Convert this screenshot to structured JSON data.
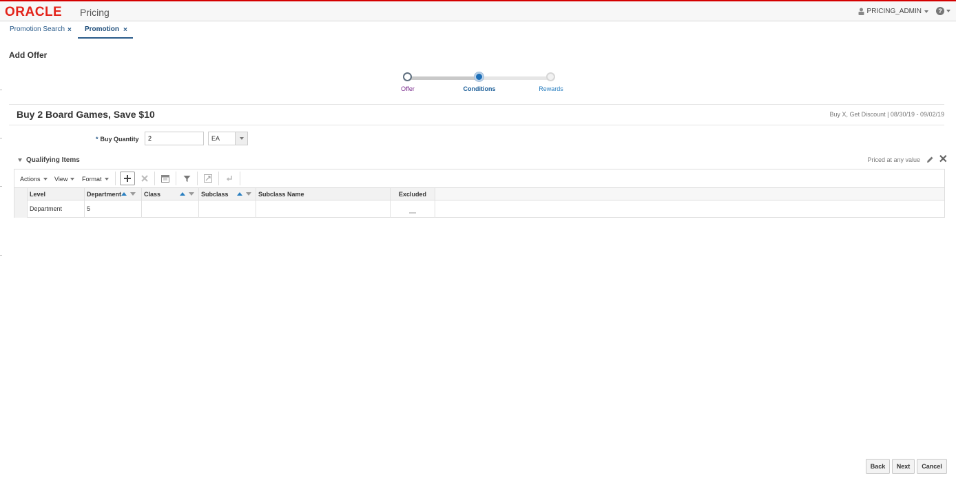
{
  "header": {
    "brand": "ORACLE",
    "app_name": "Pricing",
    "user": "PRICING_ADMIN",
    "help_glyph": "?"
  },
  "tabs": [
    {
      "label": "Promotion Search",
      "close": "×"
    },
    {
      "label": "Promotion",
      "close": "×"
    }
  ],
  "page": {
    "title": "Add Offer"
  },
  "train": {
    "steps": [
      {
        "label": "Offer",
        "state": "visited",
        "color": "#7b2d8e"
      },
      {
        "label": "Conditions",
        "state": "current",
        "color": "#1d5f99"
      },
      {
        "label": "Rewards",
        "state": "unvisited",
        "color": "#2a7fc0"
      }
    ]
  },
  "offer": {
    "title": "Buy 2 Board Games, Save $10",
    "meta": "Buy X, Get Discount | 08/30/19 - 09/02/19"
  },
  "form": {
    "buy_quantity_label": "Buy Quantity",
    "buy_quantity_value": "2",
    "uom_value": "EA",
    "required_marker": "*"
  },
  "qualifying": {
    "title": "Qualifying Items",
    "priced_label": "Priced at any value",
    "toolbar": {
      "actions": "Actions",
      "view": "View",
      "format": "Format"
    },
    "columns": [
      "Level",
      "Department",
      "Class",
      "Subclass",
      "Subclass Name",
      "Excluded"
    ],
    "rows": [
      {
        "level": "Department",
        "department": "5",
        "class": "",
        "subclass": "",
        "subclass_name": ""
      }
    ]
  },
  "footer": {
    "back": "Back",
    "next": "Next",
    "cancel": "Cancel"
  },
  "colors": {
    "brand_red": "#e3241b",
    "link_blue": "#2a5b8a",
    "accent_blue": "#2a7fc0"
  }
}
